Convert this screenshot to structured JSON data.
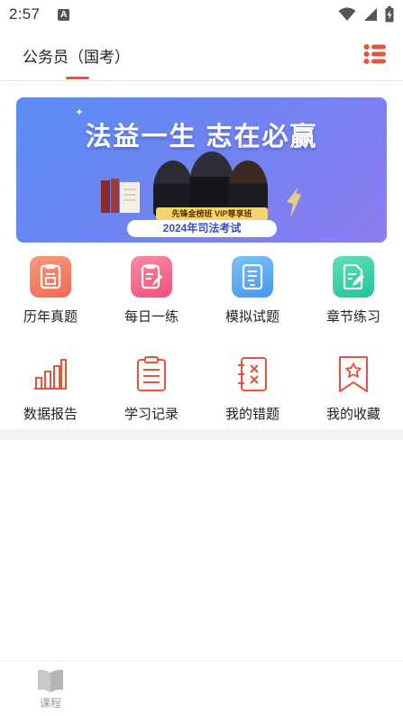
{
  "status_bar": {
    "time": "2:57",
    "notification_icon": "A"
  },
  "header": {
    "title": "公务员（国考）",
    "accent_color": "#e4543c"
  },
  "banner": {
    "slogan": "法益一生  志在必赢",
    "badge": "先锋金榜班  VIP尊享班",
    "exam": "2024年司法考试"
  },
  "features": [
    {
      "label": "历年真题",
      "icon": "past-exam-icon",
      "color": "#f0735a"
    },
    {
      "label": "每日一练",
      "icon": "daily-practice-icon",
      "color": "#f2577d"
    },
    {
      "label": "模拟试题",
      "icon": "mock-test-icon",
      "color": "#4ea7f0"
    },
    {
      "label": "章节练习",
      "icon": "chapter-practice-icon",
      "color": "#2fcfa3"
    },
    {
      "label": "数据报告",
      "icon": "data-report-icon",
      "color": "#e4543c"
    },
    {
      "label": "学习记录",
      "icon": "study-record-icon",
      "color": "#e4543c"
    },
    {
      "label": "我的错题",
      "icon": "wrong-questions-icon",
      "color": "#e4543c"
    },
    {
      "label": "我的收藏",
      "icon": "favorites-icon",
      "color": "#e4543c"
    }
  ],
  "bottom_nav": {
    "items": [
      {
        "label": "课程",
        "icon": "book-icon"
      }
    ]
  }
}
